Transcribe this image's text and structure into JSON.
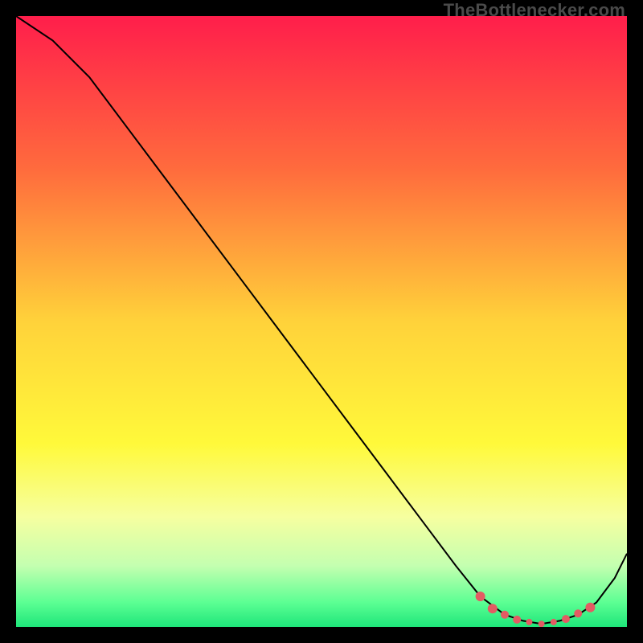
{
  "watermark": "TheBottlenecker.com",
  "chart_data": {
    "type": "line",
    "title": "",
    "xlabel": "",
    "ylabel": "",
    "xlim": [
      0,
      100
    ],
    "ylim": [
      0,
      100
    ],
    "grid": false,
    "series": [
      {
        "name": "curve",
        "x": [
          0,
          6,
          12,
          18,
          24,
          30,
          36,
          42,
          48,
          54,
          60,
          66,
          72,
          76,
          80,
          83,
          86,
          89,
          92,
          95,
          98,
          100
        ],
        "values": [
          100,
          96,
          90,
          82,
          74,
          66,
          58,
          50,
          42,
          34,
          26,
          18,
          10,
          5,
          2,
          1,
          0.5,
          1,
          2,
          4,
          8,
          12
        ]
      }
    ],
    "markers": {
      "name": "highlighted-points",
      "color": "#e35b63",
      "x": [
        76,
        78,
        80,
        82,
        84,
        86,
        88,
        90,
        92,
        94
      ],
      "values": [
        5,
        3,
        2,
        1.2,
        0.8,
        0.5,
        0.8,
        1.3,
        2.2,
        3.2
      ],
      "sizes": [
        6,
        6,
        5,
        5,
        4,
        4,
        4,
        5,
        5,
        6
      ]
    },
    "gradient_stops": [
      {
        "offset": 0.0,
        "color": "#ff1e4b"
      },
      {
        "offset": 0.25,
        "color": "#ff6b3d"
      },
      {
        "offset": 0.5,
        "color": "#ffd23a"
      },
      {
        "offset": 0.7,
        "color": "#fff93a"
      },
      {
        "offset": 0.82,
        "color": "#f6ffa0"
      },
      {
        "offset": 0.9,
        "color": "#c4ffb0"
      },
      {
        "offset": 0.96,
        "color": "#5cff93"
      },
      {
        "offset": 1.0,
        "color": "#1ee67a"
      }
    ]
  }
}
